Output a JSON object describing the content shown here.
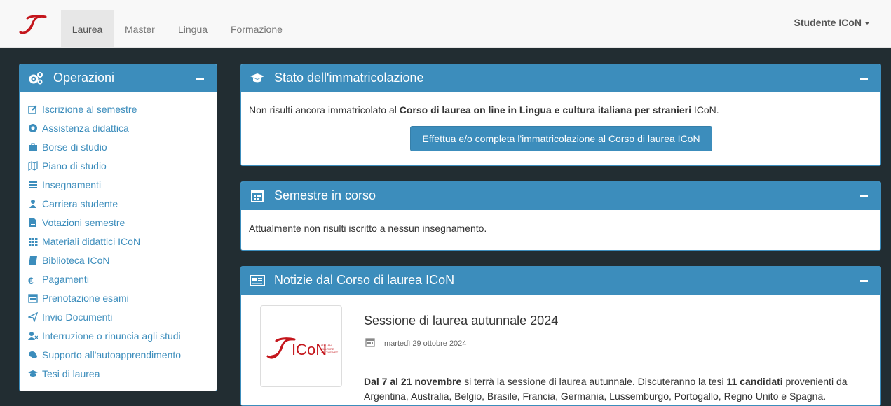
{
  "nav": {
    "brand": "I",
    "links": [
      "Laurea",
      "Master",
      "Lingua",
      "Formazione"
    ],
    "user": "Studente ICoN"
  },
  "operazioni": {
    "title": "Operazioni",
    "items": [
      {
        "label": "Iscrizione al semestre",
        "icon": "edit-icon"
      },
      {
        "label": "Assistenza didattica",
        "icon": "lifebuoy-icon"
      },
      {
        "label": "Borse di studio",
        "icon": "briefcase-icon"
      },
      {
        "label": "Piano di studio",
        "icon": "map-icon"
      },
      {
        "label": "Insegnamenti",
        "icon": "list-icon"
      },
      {
        "label": "Carriera studente",
        "icon": "user-icon"
      },
      {
        "label": "Votazioni semestre",
        "icon": "file-icon"
      },
      {
        "label": "Materiali didattici ICoN",
        "icon": "grid-icon"
      },
      {
        "label": "Biblioteca ICoN",
        "icon": "book-icon"
      },
      {
        "label": "Pagamenti",
        "icon": "euro-icon"
      },
      {
        "label": "Prenotazione esami",
        "icon": "calendar-icon"
      },
      {
        "label": "Invio Documenti",
        "icon": "send-icon"
      },
      {
        "label": "Interruzione o rinuncia agli studi",
        "icon": "user-remove-icon"
      },
      {
        "label": "Supporto all'autoapprendimento",
        "icon": "chat-icon"
      },
      {
        "label": "Tesi di laurea",
        "icon": "graduation-cap-icon"
      }
    ]
  },
  "stato": {
    "title": "Stato dell'immatricolazione",
    "text_pre": "Non risulti ancora immatricolato al ",
    "text_bold": "Corso di laurea on line in Lingua e cultura italiana per stranieri",
    "text_post": " ICoN.",
    "cta": "Effettua e/o completa l'immatricolazione al Corso di laurea ICoN"
  },
  "semestre": {
    "title": "Semestre in corso",
    "text": "Attualmente non risulti iscritto a nessun insegnamento."
  },
  "notizie": {
    "title": "Notizie dal Corso di laurea ICoN",
    "item_title": "Sessione di laurea autunnale 2024",
    "item_date": "martedì 29 ottobre 2024",
    "thumb_brand": "ICoN",
    "thumb_tagline": "ITALIAN CULTURE ON THE NET",
    "p1_bold": "Dal 7 al 21 novembre",
    "p1_a": " si terrà la sessione di laurea autunnale. Discuteranno la tesi ",
    "p1_bold2": "11 candidati",
    "p1_b": " provenienti da Argentina, Australia, Belgio, Brasile, Francia, Germania, Lussemburgo, Portogallo, Regno Unito e Spagna."
  },
  "colors": {
    "accent": "#3c8dbc",
    "page_bg": "#222d32",
    "brand_red": "#c4161c"
  }
}
